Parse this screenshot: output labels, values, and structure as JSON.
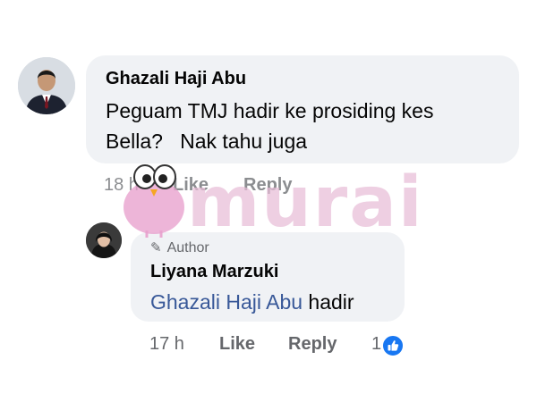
{
  "comment": {
    "author": "Ghazali Haji Abu",
    "text": "Peguam TMJ hadir ke prosiding kes\nBella?   Nak tahu juga",
    "actions": {
      "time": "18 h",
      "like_label": "Like",
      "reply_label": "Reply"
    }
  },
  "reply": {
    "badge": "Author",
    "author": "Liyana Marzuki",
    "mention": "Ghazali Haji Abu",
    "text_after_mention": " hadir",
    "actions": {
      "time": "17 h",
      "like_label": "Like",
      "reply_label": "Reply",
      "reaction_count": "1"
    }
  },
  "watermark": {
    "text": "murai"
  },
  "icons": {
    "author_badge": "pencil-icon",
    "reaction": "thumbs-up-icon",
    "watermark_logo": "bird-icon"
  },
  "colors": {
    "bubble_bg": "#f0f2f5",
    "mention": "#385898",
    "meta_text": "#65676b",
    "like_blue": "#1877f2",
    "watermark": "#e8bcd7"
  }
}
